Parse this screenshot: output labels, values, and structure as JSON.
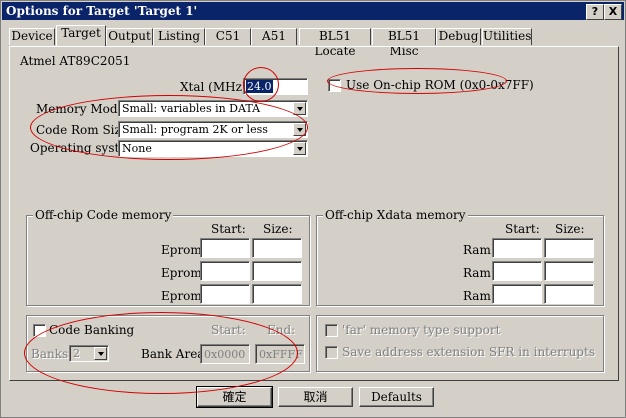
{
  "window": {
    "title": "Options for Target 'Target 1'",
    "help_label": "?",
    "close_label": "X"
  },
  "tabs": [
    {
      "label": "Device"
    },
    {
      "label": "Target"
    },
    {
      "label": "Output"
    },
    {
      "label": "Listing"
    },
    {
      "label": "C51"
    },
    {
      "label": "A51"
    },
    {
      "label": "BL51 Locate"
    },
    {
      "label": "BL51 Misc"
    },
    {
      "label": "Debug"
    },
    {
      "label": "Utilities"
    }
  ],
  "active_tab": "Target",
  "device_name": "Atmel AT89C2051",
  "xtal": {
    "label": "Xtal (MHz):",
    "value": "24.0"
  },
  "onchip_rom": {
    "label": "Use On-chip ROM (0x0-0x7FF)",
    "checked": false
  },
  "memory_model": {
    "label": "Memory Model:",
    "value": "Small: variables in DATA"
  },
  "code_rom_size": {
    "label": "Code Rom Size:",
    "value": "Small: program 2K or less"
  },
  "operating_system": {
    "label": "Operating system:",
    "value": "None"
  },
  "offchip_code": {
    "title": "Off-chip Code memory",
    "start_header": "Start:",
    "size_header": "Size:",
    "rows": [
      {
        "label": "Eprom"
      },
      {
        "label": "Eprom"
      },
      {
        "label": "Eprom"
      }
    ]
  },
  "offchip_xdata": {
    "title": "Off-chip Xdata memory",
    "start_header": "Start:",
    "size_header": "Size:",
    "rows": [
      {
        "label": "Ram"
      },
      {
        "label": "Ram"
      },
      {
        "label": "Ram"
      }
    ]
  },
  "code_banking": {
    "label": "Code Banking",
    "checked": false,
    "start_header": "Start:",
    "end_header": "End:",
    "banks_label": "Banks:",
    "banks_value": "2",
    "bank_area_label": "Bank Area:",
    "bank_start": "0x0000",
    "bank_end": "0xFFFF"
  },
  "far_memory": {
    "label": "'far' memory type support",
    "checked": false
  },
  "save_sfr": {
    "label": "Save address extension SFR in interrupts",
    "checked": false
  },
  "buttons": {
    "ok": "確定",
    "cancel": "取消",
    "defaults": "Defaults"
  },
  "annotation_color": "#d40000"
}
